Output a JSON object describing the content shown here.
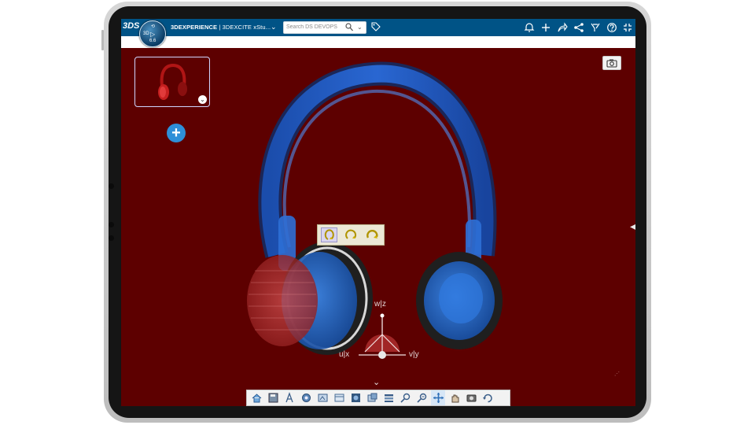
{
  "header": {
    "brand": "3DEXPERIENCE",
    "separator": " | ",
    "app": "3DEXCITE",
    "app_suffix": " xStu..."
  },
  "search": {
    "placeholder": "Search DS DEVOPS"
  },
  "viewer": {
    "axis_labels": {
      "vertical": "w|z",
      "left": "u|x",
      "right": "v|y"
    },
    "background_color": "#5d0000",
    "model_color": "#1f5cc8",
    "accent_color": "#005386"
  },
  "icons": {
    "topbar": [
      "ds-logo-icon",
      "compass-icon",
      "chevron-down-icon",
      "search-icon",
      "tag-icon",
      "notification-icon",
      "add-icon",
      "share-icon",
      "network-icon",
      "tools-icon",
      "help-icon",
      "fullscreen-icon"
    ],
    "bottom_toolbar": [
      "home-icon",
      "save-icon",
      "text-style-icon",
      "settings-icon",
      "view-mode-icon",
      "frame-icon",
      "render-icon",
      "capture-icon",
      "layers-icon",
      "search-zoom-icon",
      "zoom-icon",
      "move-icon",
      "pan-icon",
      "camera-icon",
      "refresh-icon"
    ]
  }
}
